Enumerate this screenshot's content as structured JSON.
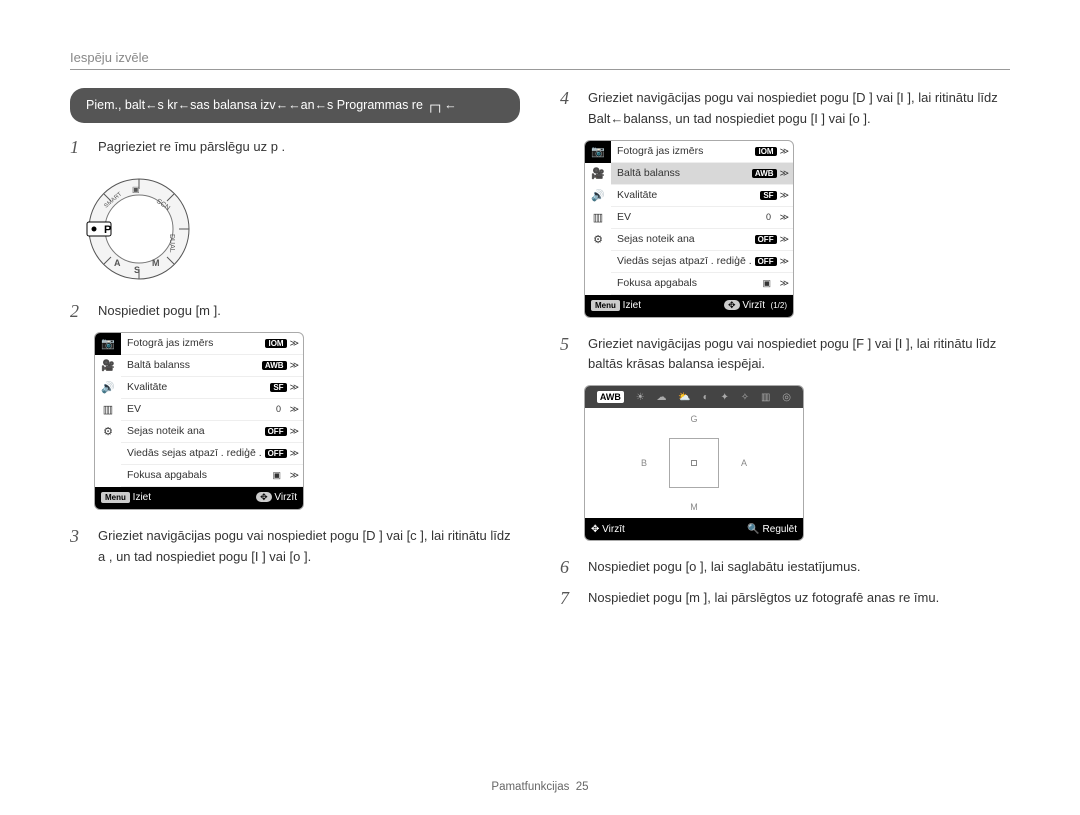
{
  "header": "Iespēju izvēle",
  "pill": "Piem., balt←s kr←sas balansa izv←←an←s Programmas re  ┌┐←",
  "left": {
    "step1": {
      "num": "1",
      "text": "Pagrieziet re īmu pārslēgu uz p ."
    },
    "step2": {
      "num": "2",
      "text": "Nospiediet pogu [m        ]."
    },
    "step3": {
      "num": "3",
      "text": "Grieziet navigācijas pogu vai nospiediet pogu [D        ] vai [c   ], lai ritinātu līdz a   , un tad nospiediet pogu [I      ] vai [o  ]."
    }
  },
  "right": {
    "step4": {
      "num": "4",
      "text": "Grieziet navigācijas pogu vai nospiediet pogu [D        ] vai [I       ], lai ritinātu līdz Balt←balanss, un tad nospiediet pogu [I        ] vai [o  ]."
    },
    "step5": {
      "num": "5",
      "text": "Grieziet navigācijas pogu vai nospiediet pogu [F  ] vai [I       ], lai ritinātu līdz baltās krāsas balansa iespējai."
    },
    "step6": {
      "num": "6",
      "text": "Nospiediet pogu [o  ], lai saglabātu iestatījumus."
    },
    "step7": {
      "num": "7",
      "text": "Nospiediet pogu [m        ], lai pārslēgtos uz fotografē anas re īmu."
    }
  },
  "menu": {
    "rows": [
      {
        "label": "Fotogrā jas izmērs",
        "val": "IOM"
      },
      {
        "label": "Baltā balanss",
        "val": "AWB"
      },
      {
        "label": "Kvalitāte",
        "val": "SF"
      },
      {
        "label": "EV",
        "val": "0"
      },
      {
        "label": "Sejas noteik ana",
        "val": "OFF"
      },
      {
        "label": "Viedās sejas atpazī . rediģē .",
        "val": "OFF"
      },
      {
        "label": "Fokusa apgabals",
        "val": "▣"
      }
    ],
    "footer": {
      "btn": "Menu",
      "exit": "Iziet",
      "move": "Virzīt",
      "page": "(1/2)"
    }
  },
  "wb": {
    "labels": {
      "G": "G",
      "B": "B",
      "A": "A",
      "M": "M"
    },
    "selected": "AWB",
    "footer": {
      "move": "Virzīt",
      "adjust": "Regulēt"
    }
  },
  "footer": {
    "label": "Pamatfunkcijas",
    "page": "25"
  }
}
